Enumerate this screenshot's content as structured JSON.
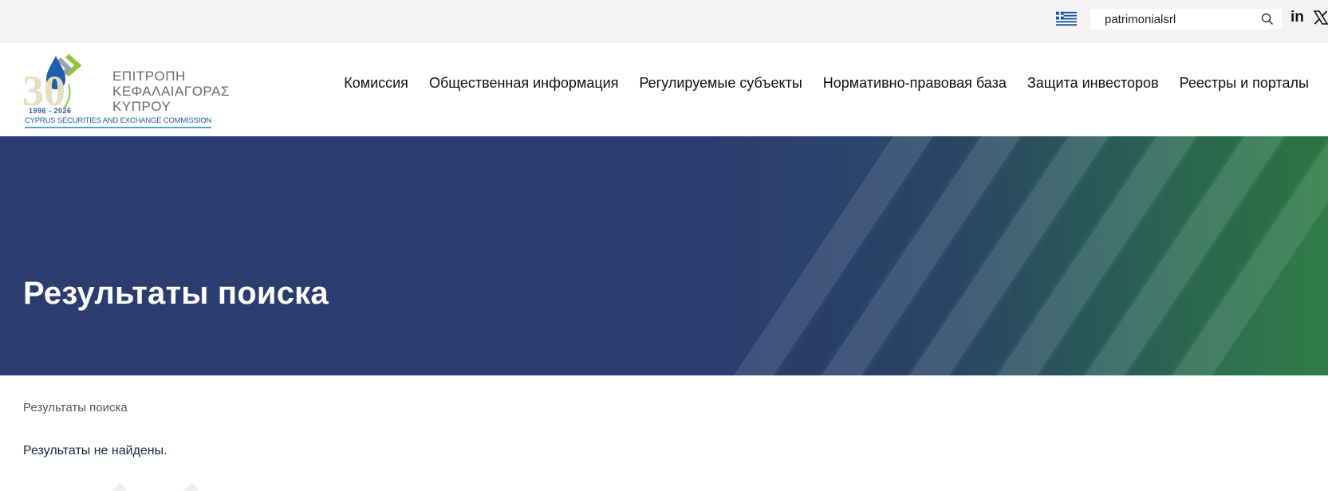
{
  "topbar": {
    "search": {
      "value": "patrimonialsrl",
      "placeholder": ""
    },
    "icons": {
      "language": "greek-flag-icon",
      "search": "search-icon",
      "linkedin": "linkedin-icon",
      "x": "x-twitter-icon"
    },
    "linkedin_glyph": "in"
  },
  "logo": {
    "line1": "ΕΠΙΤΡΟΠΗ",
    "line2": "ΚΕΦΑΛΑΙΑΓΟΡΑΣ",
    "line3": "ΚΥΠΡΟΥ",
    "years": "1996 - 2026",
    "anniversary": "30",
    "english": "CYPRUS SECURITIES AND EXCHANGE COMMISSION"
  },
  "nav": {
    "items": [
      {
        "label": "Комиссия"
      },
      {
        "label": "Общественная информация"
      },
      {
        "label": "Регулируемые субъекты"
      },
      {
        "label": "Нормативно-правовая база"
      },
      {
        "label": "Защита инвесторов"
      },
      {
        "label": "Реестры и порталы"
      }
    ]
  },
  "hero": {
    "title": "Результаты поиска"
  },
  "main": {
    "breadcrumb": "Результаты поиска",
    "no_results": "Результаты не найдены."
  },
  "colors": {
    "topbar_bg": "#f4f2f2",
    "hero_bg": "#2b3c70",
    "hero_accent_green": "#2e7a48",
    "nav_text": "#111111"
  }
}
